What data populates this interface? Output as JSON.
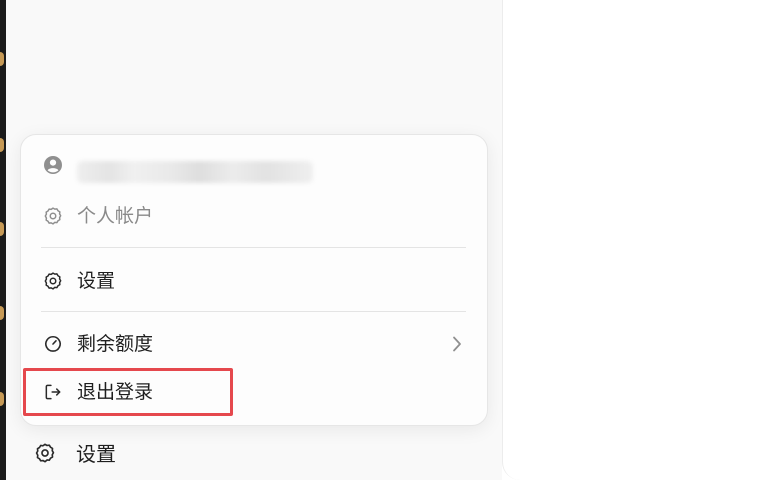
{
  "menu": {
    "account_email": "",
    "personal_account_label": "个人帐户",
    "settings_label": "设置",
    "remaining_quota_label": "剩余额度",
    "logout_label": "退出登录"
  },
  "sidebar": {
    "settings_label": "设置"
  },
  "icons": {
    "account": "user-circle-icon",
    "personal_account": "gear-icon",
    "settings": "gear-icon",
    "quota": "gauge-icon",
    "logout": "logout-icon",
    "submenu": "chevron-right-icon"
  },
  "colors": {
    "highlight": "#e5484d",
    "muted_text": "#8a8a8a",
    "text": "#1f1f1f"
  }
}
